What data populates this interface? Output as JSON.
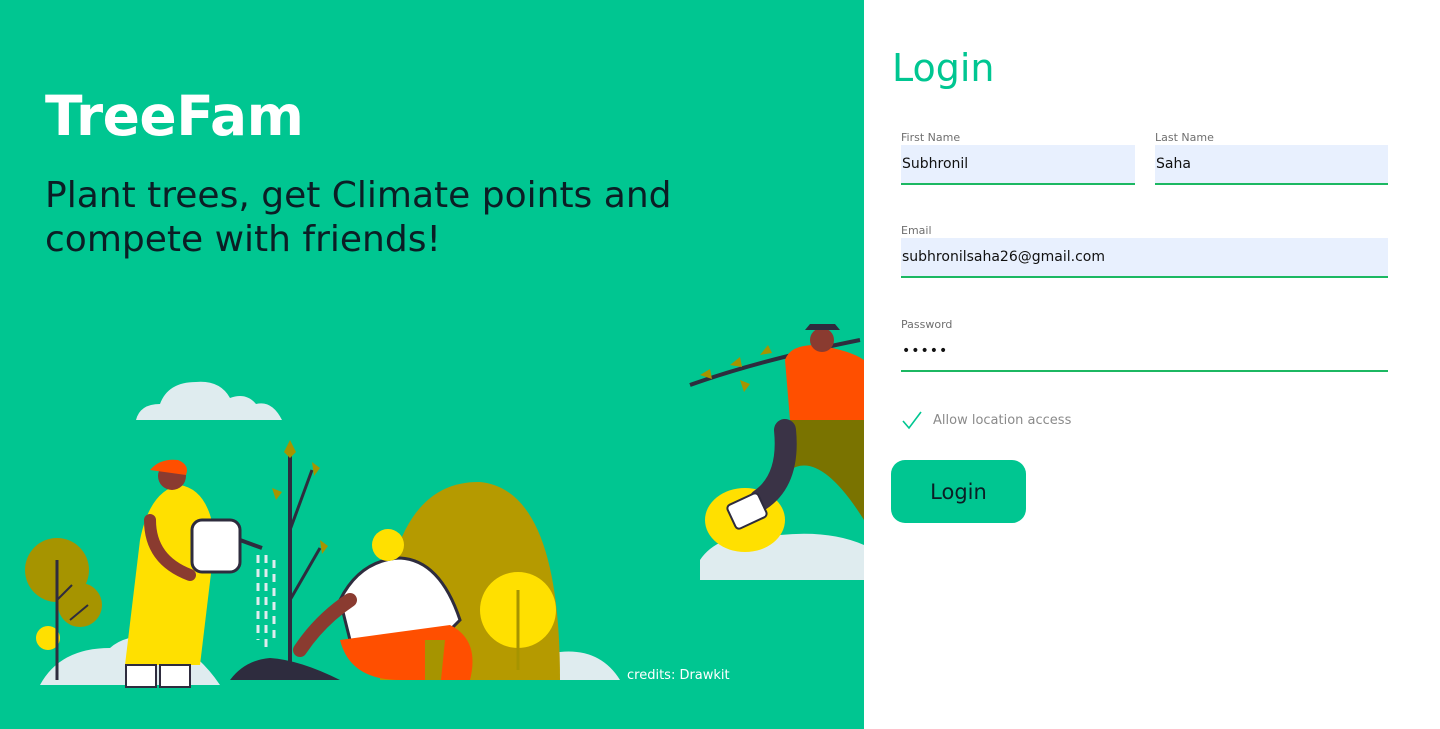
{
  "brand": {
    "name": "TreeFam",
    "tagline": "Plant trees, get Climate points and compete with friends!",
    "credits": "credits: Drawkit"
  },
  "form": {
    "title": "Login",
    "first_name": {
      "label": "First Name",
      "value": "Subhronil"
    },
    "last_name": {
      "label": "Last Name",
      "value": "Saha"
    },
    "email": {
      "label": "Email",
      "value": "subhronilsaha26@gmail.com"
    },
    "password": {
      "label": "Password",
      "value": "•••••"
    },
    "location": {
      "label": "Allow location access",
      "checked": true
    },
    "submit_label": "Login"
  },
  "illustration": {
    "description_icons": [
      "cloud-icon",
      "gardener-figure",
      "planter-figure",
      "walker-figure",
      "sapling-icon",
      "bush-icon"
    ]
  },
  "colors": {
    "accent": "#00c691",
    "field_bg": "#e8f0fe",
    "field_underline": "#1cb862",
    "text_dark": "#0b1e25"
  }
}
